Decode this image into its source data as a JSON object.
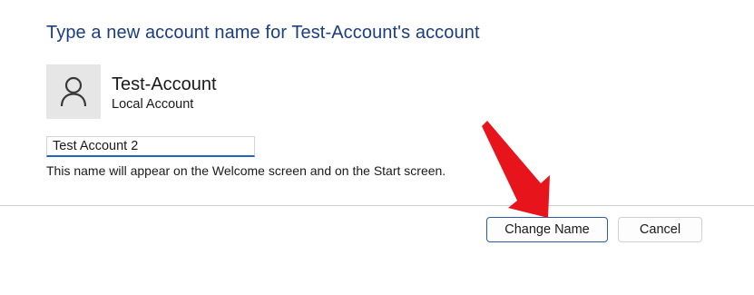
{
  "dialog": {
    "heading": "Type a new account name for Test-Account's account"
  },
  "account": {
    "name": "Test-Account",
    "type": "Local Account",
    "avatar_icon": "user-icon"
  },
  "name_field": {
    "value": "Test Account 2",
    "hint": "This name will appear on the Welcome screen and on the Start screen."
  },
  "buttons": {
    "change_name": "Change Name",
    "cancel": "Cancel"
  },
  "annotation": {
    "icon": "red-arrow-pointer",
    "color": "#e8141b"
  }
}
